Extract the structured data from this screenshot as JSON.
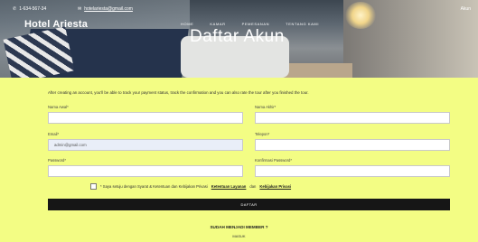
{
  "topbar": {
    "phone": "1-634-567-34",
    "email": "hotelariesta@gmail.com",
    "account_label": "Akun"
  },
  "header": {
    "brand": "Hotel Ariesta",
    "nav": [
      "HOME",
      "KAMAR",
      "PEMESANAN",
      "TENTANG KAMI"
    ],
    "page_title": "Daftar Akun"
  },
  "form": {
    "intro": "After creating an account, you'll be able to track your payment status, track the confirmation and you can also rate the tour after you finished the tour.",
    "fields": {
      "first_name": {
        "label": "Nama Awal*",
        "value": ""
      },
      "last_name": {
        "label": "Nama Akhir*",
        "value": ""
      },
      "email": {
        "label": "Email*",
        "value": "admin@gmail.com"
      },
      "phone": {
        "label": "Telepon*",
        "value": ""
      },
      "password": {
        "label": "Password*",
        "value": ""
      },
      "confirm_password": {
        "label": "Konfirmasi Password*",
        "value": ""
      }
    },
    "agree_text": "* Saya setuju dengan Syarat & Ketentuan dan Kebijakan Privasi",
    "agree_link1": "Ketentuan Layanan",
    "agree_sep": "dan",
    "agree_link2": "Kebijakan Privasi",
    "submit_label": "DAFTAR"
  },
  "footer": {
    "member_text": "SUDAH MENJADI MEMBER ?",
    "login_label": "MASUK"
  },
  "colors": {
    "page_bg": "#f3fd84",
    "button_bg": "#161616"
  }
}
